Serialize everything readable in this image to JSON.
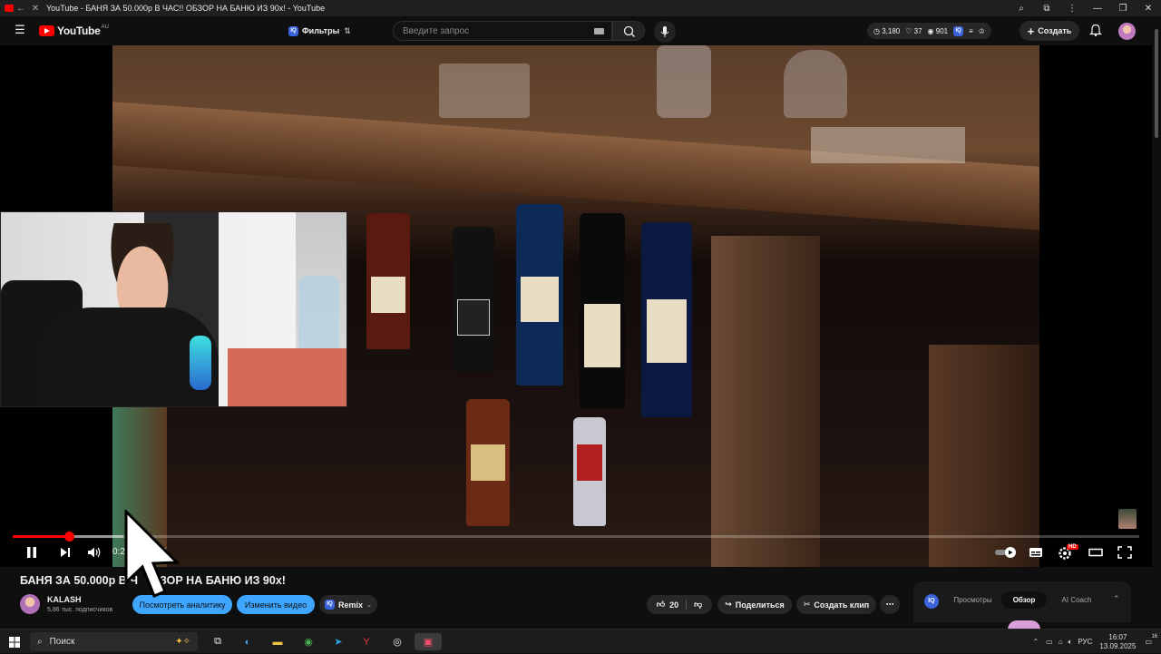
{
  "window": {
    "title": "YouTube - БАНЯ ЗА 50.000р В ЧАС!! ОБЗОР НА БАНЮ ИЗ 90х! - YouTube"
  },
  "masthead": {
    "logo_text": "YouTube",
    "region": "AU",
    "filters_label": "Фильтры",
    "filters_badge": "IQ",
    "search_placeholder": "Введите запрос",
    "stats": [
      "3,180",
      "37",
      "901"
    ],
    "create_label": "Создать"
  },
  "player": {
    "time_current": "0:2",
    "time_partial_total": "5",
    "progress_fraction": 0.05,
    "hd_badge": "HD"
  },
  "video": {
    "title_visible_left": "БАНЯ ЗА 50.000р В Ч",
    "title_visible_right": "ЗОР НА БАНЮ ИЗ 90х!",
    "channel_name": "KALASH",
    "subscribers": "5,86 тыс. подписчиков",
    "analytics_label": "Посмотреть аналитику",
    "edit_label": "Изменить видео",
    "remix_label": "Remix",
    "likes": "20",
    "share_label": "Поделиться",
    "clip_label": "Создать клип"
  },
  "side_panel": {
    "badge": "IQ",
    "tabs": [
      "Просмотры",
      "Обзор",
      "AI Coach"
    ],
    "active_tab": "Обзор"
  },
  "taskbar": {
    "search_label": "Поиск",
    "language": "РУС",
    "time": "16:07",
    "date": "13.09.2025",
    "notifications": "16"
  },
  "colors": {
    "accent_red": "#ff0000",
    "link_blue": "#3ea6ff",
    "background": "#0f0f0f"
  }
}
